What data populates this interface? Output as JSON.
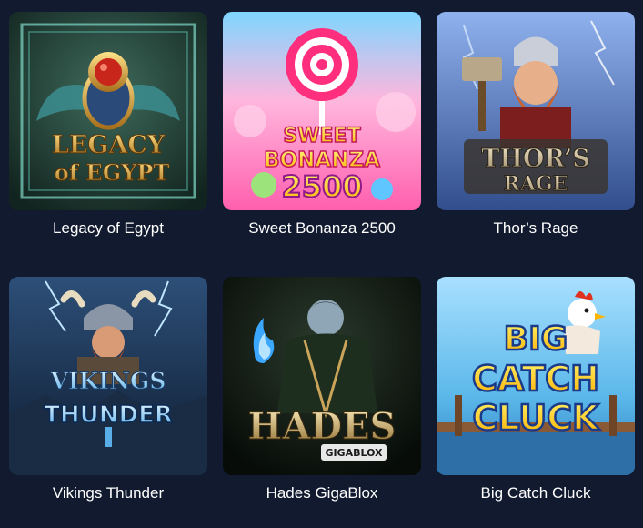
{
  "games": [
    {
      "title": "Legacy of Egypt",
      "logo_line1": "LEGACY",
      "logo_line2": "of EGYPT",
      "colors": {
        "bg": "#23423a",
        "accent": "#d9a441"
      }
    },
    {
      "title": "Sweet Bonanza 2500",
      "logo_line1": "SWEET",
      "logo_line2": "BONANZA",
      "logo_line3": "2500",
      "colors": {
        "bg": "#ff8fc8",
        "accent": "#ffe033"
      }
    },
    {
      "title": "Thor’s Rage",
      "logo_line1": "THOR’S",
      "logo_line2": "RAGE",
      "colors": {
        "bg": "#6b8fd8",
        "accent": "#d8c7a0"
      }
    },
    {
      "title": "Vikings Thunder",
      "logo_line1": "VIKINGS",
      "logo_line2": "THUNDER",
      "colors": {
        "bg": "#1e3a5c",
        "accent": "#7fc8ff"
      }
    },
    {
      "title": "Hades GigaBlox",
      "logo_line1": "HADES",
      "logo_line2": "GIGABLOX",
      "colors": {
        "bg": "#0f1a12",
        "accent": "#c9a45a"
      }
    },
    {
      "title": "Big Catch Cluck",
      "logo_line1": "BIG",
      "logo_line2": "CATCH",
      "logo_line3": "CLUCK",
      "colors": {
        "bg": "#6cc4ee",
        "accent": "#ffd21a"
      }
    }
  ]
}
